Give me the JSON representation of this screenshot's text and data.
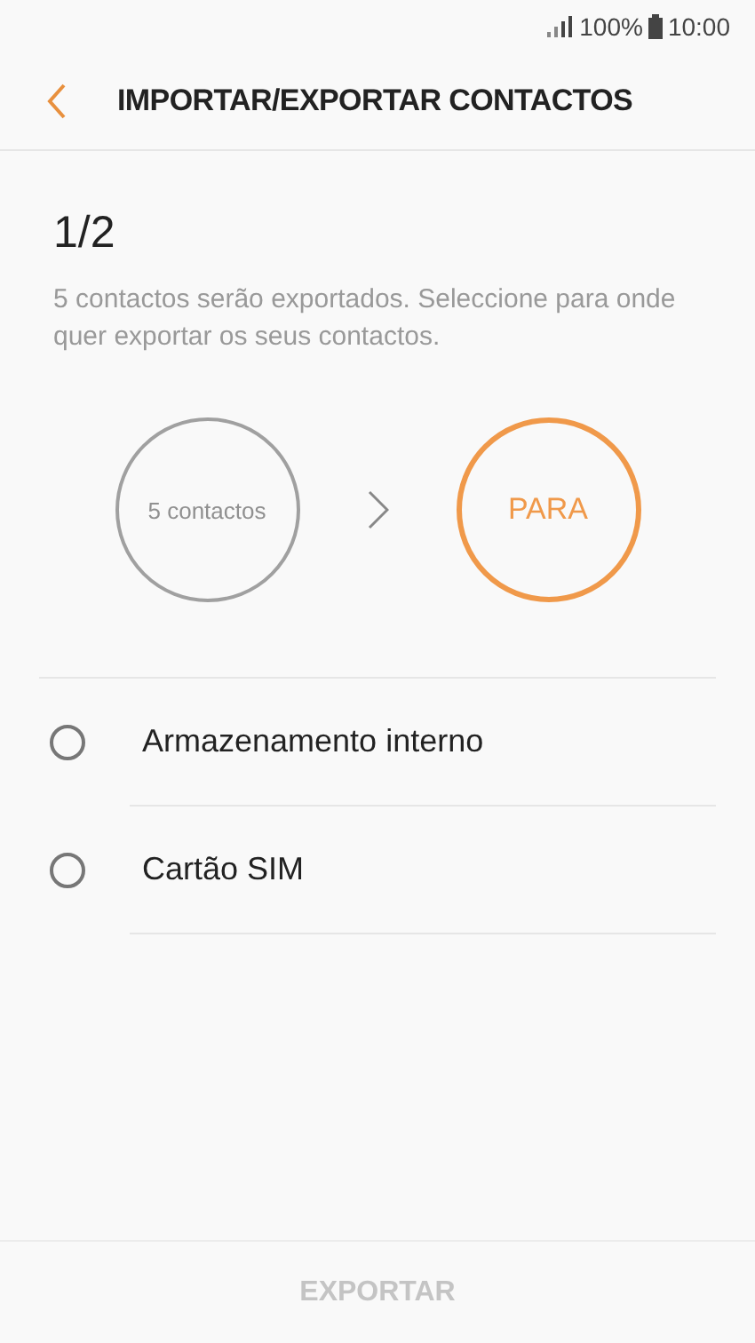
{
  "status_bar": {
    "battery": "100%",
    "time": "10:00"
  },
  "header": {
    "title": "IMPORTAR/EXPORTAR CONTACTOS"
  },
  "step": "1/2",
  "description": "5 contactos serão exportados. Seleccione para onde quer exportar os seus contactos.",
  "flow": [
    {
      "label": "5 contactos",
      "active": false
    },
    {
      "label": "PARA",
      "active": true
    }
  ],
  "options": [
    {
      "label": "Armazenamento interno",
      "selected": false
    },
    {
      "label": "Cartão SIM",
      "selected": false
    }
  ],
  "export_button": {
    "label": "EXPORTAR",
    "disabled": true
  }
}
